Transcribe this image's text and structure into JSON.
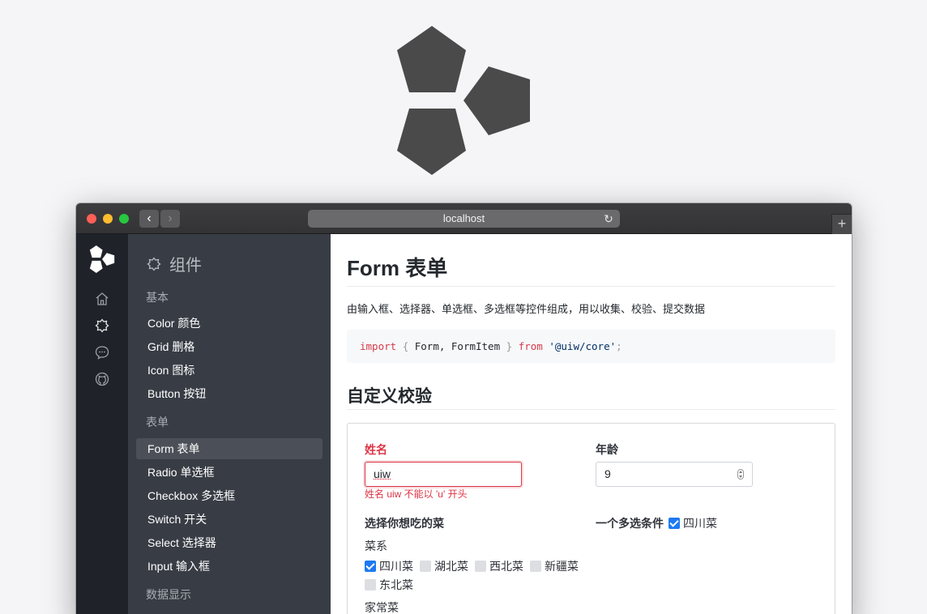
{
  "browser": {
    "address": "localhost",
    "back_glyph": "‹",
    "forward_glyph": "›",
    "reload_glyph": "↻",
    "new_tab_glyph": "+"
  },
  "icons": [
    "home-icon",
    "component-icon",
    "message-icon",
    "github-icon"
  ],
  "sidebar": {
    "title": "组件",
    "groups": [
      {
        "label": "基本",
        "items": [
          "Color 颜色",
          "Grid 删格",
          "Icon 图标",
          "Button 按钮"
        ]
      },
      {
        "label": "表单",
        "items": [
          "Form 表单",
          "Radio 单选框",
          "Checkbox 多选框",
          "Switch 开关",
          "Select 选择器",
          "Input 输入框"
        ]
      },
      {
        "label": "数据显示",
        "items": []
      }
    ],
    "active_item": "Form 表单"
  },
  "content": {
    "title": "Form 表单",
    "description": "由输入框、选择器、单选框、多选框等控件组成，用以收集、校验、提交数据",
    "code": {
      "kw_import": "import",
      "brace_open": "{",
      "names": "Form, FormItem",
      "brace_close": "}",
      "kw_from": "from",
      "module": "'@uiw/core'",
      "semi": ";"
    },
    "section_title": "自定义校验",
    "form": {
      "name_label": "姓名",
      "name_value": "uiw",
      "name_error": "姓名 uiw 不能以 'u' 开头",
      "age_label": "年龄",
      "age_value": "9",
      "dish_label": "选择你想吃的菜",
      "multi_label": "一个多选条件",
      "multi_option": "四川菜",
      "cuisine_label": "菜系",
      "cuisines": [
        {
          "label": "四川菜",
          "checked": true
        },
        {
          "label": "湖北菜",
          "checked": false
        },
        {
          "label": "西北菜",
          "checked": false
        },
        {
          "label": "新疆菜",
          "checked": false
        },
        {
          "label": "东北菜",
          "checked": false
        }
      ],
      "home_label": "家常菜"
    }
  },
  "colors": {
    "accent": "#1d7af2",
    "error": "#dc3545",
    "sidebar_bg": "#383d45",
    "iconbar_bg": "#1f2329",
    "logo": "#4a4a4a"
  }
}
